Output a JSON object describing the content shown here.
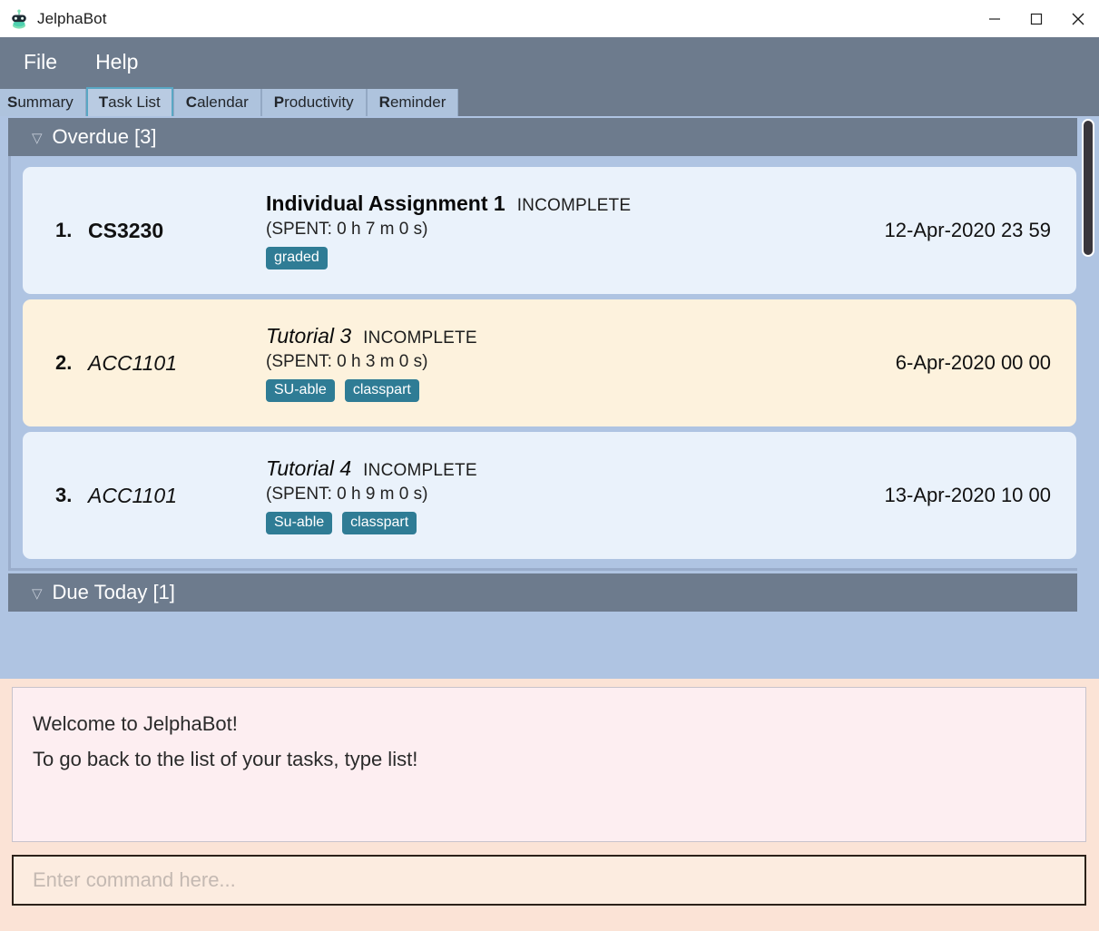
{
  "window": {
    "title": "JelphaBot",
    "icon": "robot-icon",
    "controls": [
      {
        "name": "minimize",
        "glyph": "minimize-icon"
      },
      {
        "name": "maximize",
        "glyph": "maximize-icon"
      },
      {
        "name": "close",
        "glyph": "close-icon"
      }
    ]
  },
  "menubar": {
    "items": [
      {
        "label": "File",
        "mnemonic": "F"
      },
      {
        "label": "Help",
        "mnemonic": "H"
      }
    ]
  },
  "tabs": [
    {
      "label": "Summary",
      "mnemonic": "S",
      "rest": "ummary",
      "selected": false
    },
    {
      "label": "Task List",
      "mnemonic": "T",
      "rest": "ask List",
      "selected": true
    },
    {
      "label": "Calendar",
      "mnemonic": "C",
      "rest": "alendar",
      "selected": false
    },
    {
      "label": "Productivity",
      "mnemonic": "P",
      "rest": "roductivity",
      "selected": false
    },
    {
      "label": "Reminder",
      "mnemonic": "R",
      "rest": "eminder",
      "selected": false
    }
  ],
  "sections": [
    {
      "title": "Overdue [3]",
      "count": 3,
      "collapse_icon": "chevron-down-icon",
      "tasks": [
        {
          "index": "1.",
          "module": "CS3230",
          "module_style": "bold",
          "title": "Individual Assignment 1",
          "title_style": "bold",
          "status": "INCOMPLETE",
          "spent": "(SPENT: 0 h 7 m 0 s)",
          "tags": [
            "graded"
          ],
          "date": "12-Apr-2020 23 59",
          "bg": "blue"
        },
        {
          "index": "2.",
          "module": "ACC1101",
          "module_style": "italic",
          "title": "Tutorial 3",
          "title_style": "italic",
          "status": "INCOMPLETE",
          "spent": "(SPENT: 0 h 3 m 0 s)",
          "tags": [
            "SU-able",
            "classpart"
          ],
          "date": "6-Apr-2020 00 00",
          "bg": "cream"
        },
        {
          "index": "3.",
          "module": "ACC1101",
          "module_style": "italic",
          "title": "Tutorial 4",
          "title_style": "italic",
          "status": "INCOMPLETE",
          "spent": "(SPENT: 0 h 9 m 0 s)",
          "tags": [
            "Su-able",
            "classpart"
          ],
          "date": "13-Apr-2020 10 00",
          "bg": "blue"
        }
      ]
    },
    {
      "title": "Due Today [1]",
      "count": 1,
      "collapse_icon": "chevron-down-icon",
      "tasks": []
    }
  ],
  "console": {
    "lines": [
      "Welcome to JelphaBot!",
      "To go back to the list of your tasks, type list!"
    ]
  },
  "command": {
    "value": "",
    "placeholder": "Enter command here..."
  },
  "colors": {
    "menubar": "#6d7b8d",
    "tab_bg": "#aec3dd",
    "tab_selected_border": "#59a7c4",
    "content_bg": "#afc4e2",
    "card_blue": "#eaf2fb",
    "card_cream": "#fdf2dd",
    "tag": "#2f7c95",
    "console_bg": "#fdeef1",
    "console_outer": "#fbe3d6",
    "cmd_bg": "#fcece0"
  }
}
